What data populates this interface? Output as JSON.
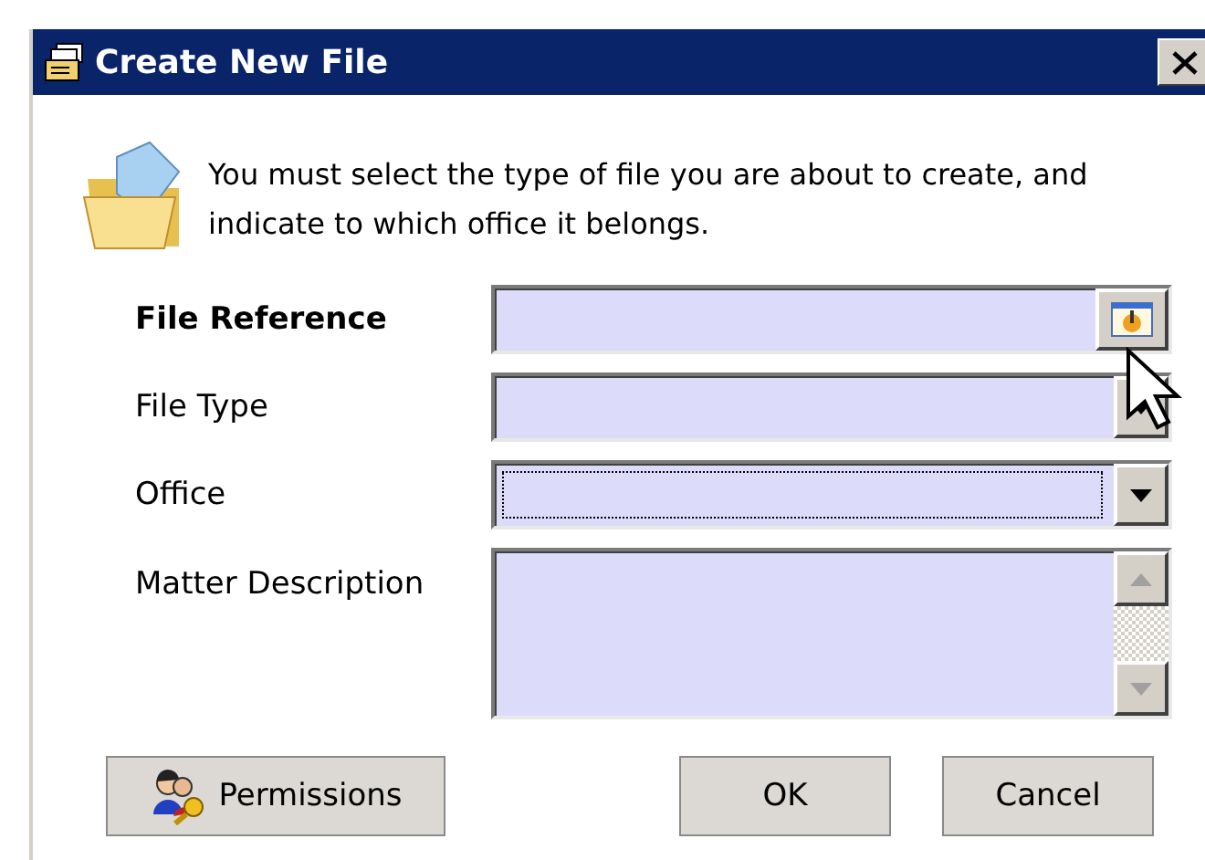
{
  "window": {
    "title": "Create New File"
  },
  "intro": "You must select the type of file you are about to create, and indicate to which office it belongs.",
  "fields": [
    {
      "label": "File Reference",
      "bold": true,
      "kind": "browse",
      "focused": false
    },
    {
      "label": "File Type",
      "bold": false,
      "kind": "combo",
      "focused": false
    },
    {
      "label": "Office",
      "bold": false,
      "kind": "combo",
      "focused": true
    },
    {
      "label": "Matter Description",
      "bold": false,
      "kind": "memo",
      "focused": false
    }
  ],
  "buttons": [
    {
      "label": "Permissions",
      "kind": "permissions"
    },
    {
      "label": "OK",
      "kind": "plain"
    },
    {
      "label": "Cancel",
      "kind": "plain"
    }
  ]
}
